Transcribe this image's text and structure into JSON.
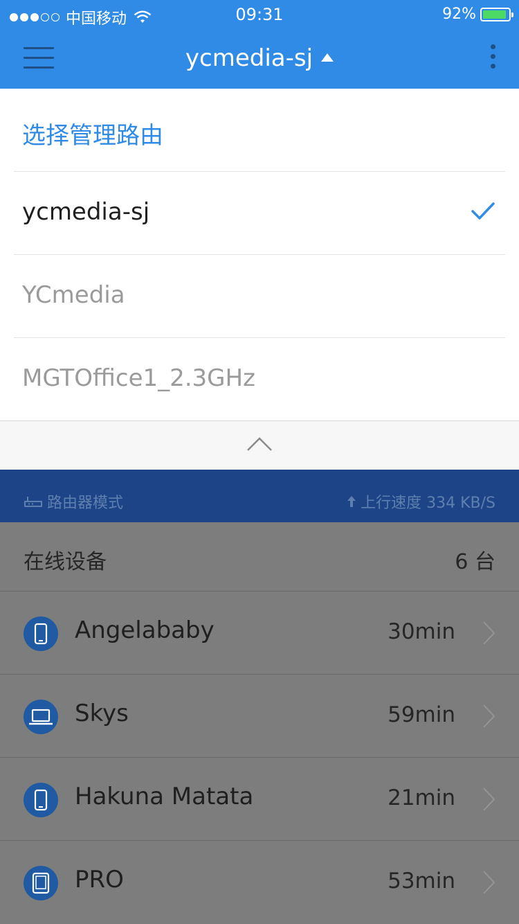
{
  "status_bar": {
    "carrier": "中国移动",
    "time": "09:31",
    "battery": "92%",
    "battery_level": 0.92,
    "signal_bars_filled": 3,
    "signal_bars_total": 5
  },
  "nav": {
    "title": "ycmedia-sj",
    "menu_icon": "hamburger-menu-icon",
    "more_icon": "more-vertical-icon"
  },
  "dropdown": {
    "header": "选择管理路由",
    "items": [
      {
        "label": "ycmedia-sj",
        "selected": true
      },
      {
        "label": "YCmedia",
        "selected": false
      },
      {
        "label": "MGTOffice1_2.3GHz",
        "selected": false
      }
    ],
    "collapse_icon": "chevron-up-icon"
  },
  "mode_bar": {
    "mode_label": "路由器模式",
    "upload_label": "上行速度 334 KB/S"
  },
  "online": {
    "label": "在线设备",
    "count": "6 台"
  },
  "devices": [
    {
      "name": "Angelababy",
      "time": "30min",
      "icon": "phone-icon"
    },
    {
      "name": "Skys",
      "time": "59min",
      "icon": "laptop-icon"
    },
    {
      "name": "Hakuna Matata",
      "time": "21min",
      "icon": "phone-icon"
    },
    {
      "name": "PRO",
      "time": "53min",
      "icon": "tablet-icon"
    }
  ],
  "colors": {
    "primary": "#2f8be6",
    "mode_bar": "#1c4487",
    "overlay_gray": "#7d7d7d",
    "device_icon_bg": "#1f5aa3",
    "battery_green": "#4cd964"
  }
}
